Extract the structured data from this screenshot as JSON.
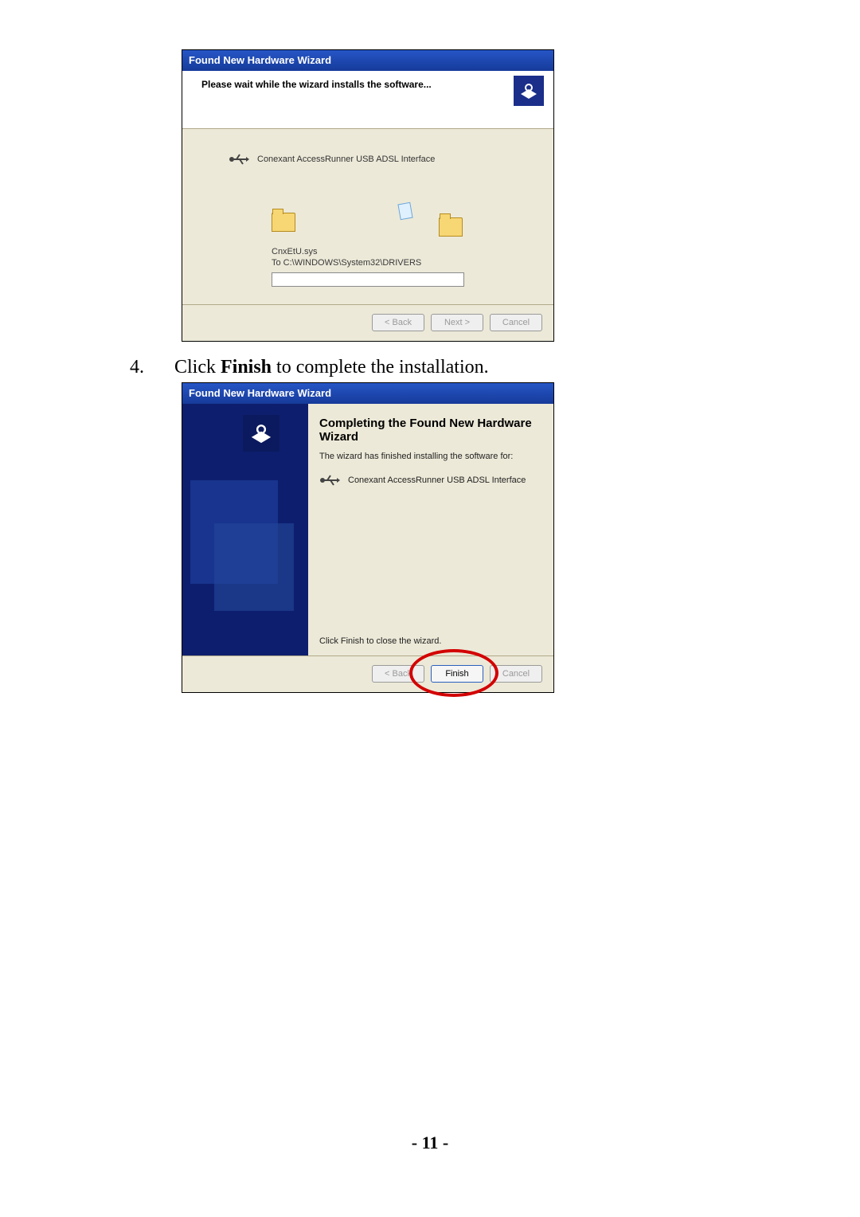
{
  "dlg1": {
    "title": "Found New Hardware Wizard",
    "header": "Please wait while the wizard installs the software...",
    "device": "Conexant AccessRunner USB ADSL Interface",
    "file": "CnxEtU.sys",
    "dest": "To C:\\WINDOWS\\System32\\DRIVERS",
    "back": "< Back",
    "next": "Next >",
    "cancel": "Cancel"
  },
  "step4": {
    "num": "4.",
    "pre": "Click ",
    "bold": "Finish",
    "post": " to complete the installation."
  },
  "dlg2": {
    "title": "Found New Hardware Wizard",
    "heading": "Completing the Found New Hardware Wizard",
    "finished": "The wizard has finished installing the software for:",
    "device": "Conexant AccessRunner USB ADSL Interface",
    "close_hint": "Click Finish to close the wizard.",
    "back": "< Back",
    "finish": "Finish",
    "cancel": "Cancel"
  },
  "page_number": "- 11 -"
}
